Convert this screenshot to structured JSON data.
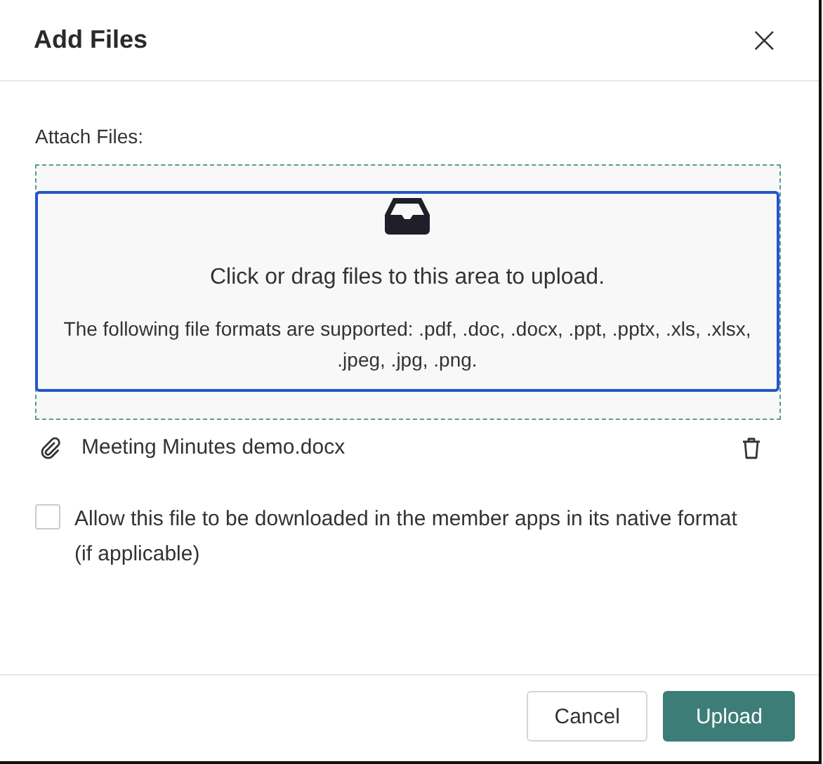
{
  "dialog": {
    "title": "Add Files",
    "close": "×"
  },
  "attach": {
    "label": "Attach Files:",
    "prompt": "Click or drag files to this area to upload.",
    "formats": "The following file formats are supported: .pdf, .doc, .docx, .ppt, .pptx, .xls, .xlsx, .jpeg, .jpg, .png."
  },
  "files": [
    {
      "name": "Meeting Minutes demo.docx"
    }
  ],
  "option": {
    "checked": false,
    "label": "Allow this file to be downloaded in the member apps in its native format",
    "note": "(if applicable)"
  },
  "buttons": [
    {
      "label": "Cancel",
      "kind": "secondary"
    },
    {
      "label": "Upload",
      "kind": "primary"
    }
  ]
}
